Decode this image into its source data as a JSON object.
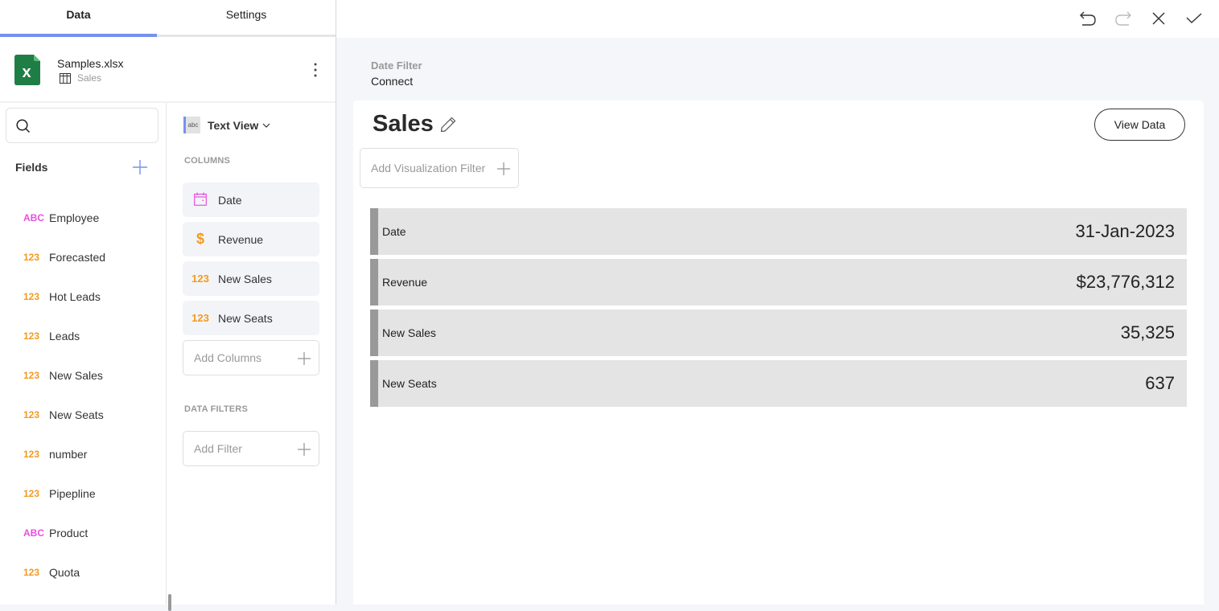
{
  "tabs": [
    {
      "label": "Data",
      "active": true
    },
    {
      "label": "Settings",
      "active": false
    }
  ],
  "source": {
    "file_name": "Samples.xlsx",
    "sheet_name": "Sales",
    "icon": "excel-icon"
  },
  "search": {
    "placeholder": "",
    "value": ""
  },
  "fields": {
    "header": "Fields",
    "items": [
      {
        "type": "ABC",
        "kind": "text",
        "label": "Employee"
      },
      {
        "type": "123",
        "kind": "number",
        "label": "Forecasted"
      },
      {
        "type": "123",
        "kind": "number",
        "label": "Hot Leads"
      },
      {
        "type": "123",
        "kind": "number",
        "label": "Leads"
      },
      {
        "type": "123",
        "kind": "number",
        "label": "New Sales"
      },
      {
        "type": "123",
        "kind": "number",
        "label": "New Seats"
      },
      {
        "type": "123",
        "kind": "number",
        "label": "number"
      },
      {
        "type": "123",
        "kind": "number",
        "label": "Pipepline"
      },
      {
        "type": "ABC",
        "kind": "text",
        "label": "Product"
      },
      {
        "type": "123",
        "kind": "number",
        "label": "Quota"
      }
    ]
  },
  "config": {
    "view_type": {
      "label": "Text View",
      "icon_text": "abc"
    },
    "columns_label": "COLUMNS",
    "columns": [
      {
        "icon": "calendar-icon",
        "label": "Date"
      },
      {
        "icon": "dollar-icon",
        "icon_text": "$",
        "label": "Revenue"
      },
      {
        "icon": "number-icon",
        "icon_text": "123",
        "label": "New Sales"
      },
      {
        "icon": "number-icon",
        "icon_text": "123",
        "label": "New Seats"
      }
    ],
    "add_columns_label": "Add Columns",
    "data_filters_label": "DATA FILTERS",
    "add_filter_label": "Add Filter"
  },
  "breadcrumb": {
    "filter_label": "Date Filter",
    "filter_value": "Connect"
  },
  "visualization": {
    "title": "Sales",
    "view_data_label": "View Data",
    "add_filter_label": "Add Visualization Filter",
    "rows": [
      {
        "label": "Date",
        "value": "31-Jan-2023"
      },
      {
        "label": "Revenue",
        "value": "$23,776,312"
      },
      {
        "label": "New Sales",
        "value": "35,325"
      },
      {
        "label": "New Seats",
        "value": "637"
      }
    ]
  },
  "colors": {
    "accent": "#7592f0",
    "number_type": "#f39a1f",
    "text_type": "#e94fe0",
    "excel_green": "#1e7e45",
    "row_marker": "#999999",
    "row_bg": "#e4e4e4"
  }
}
